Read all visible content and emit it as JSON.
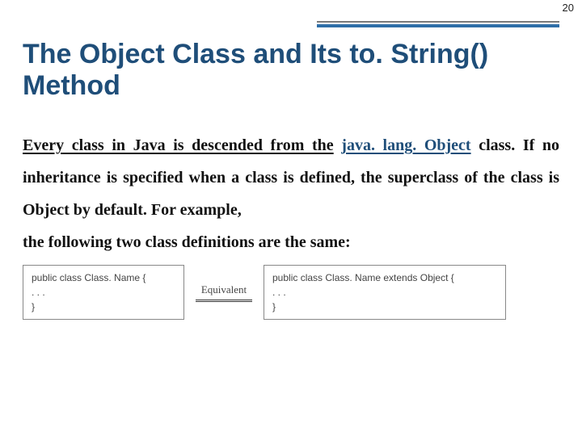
{
  "page_number": "20",
  "title": "The Object Class and Its to. String() Method",
  "para": {
    "u1": "Every class in Java is descended from the",
    "u2": "java. lang. Object",
    "rest1": " class. If no inheritance is specified when a class is defined, the superclass of the class is Object by default. For example,",
    "line2": "the following two class definitions are the same:"
  },
  "equivalent_label": "Equivalent",
  "code_left": {
    "l1": "public class Class. Name {",
    "l2": ". . .",
    "l3": "}"
  },
  "code_right": {
    "l1": "public class Class. Name extends Object {",
    "l2": ". . .",
    "l3": "}"
  }
}
